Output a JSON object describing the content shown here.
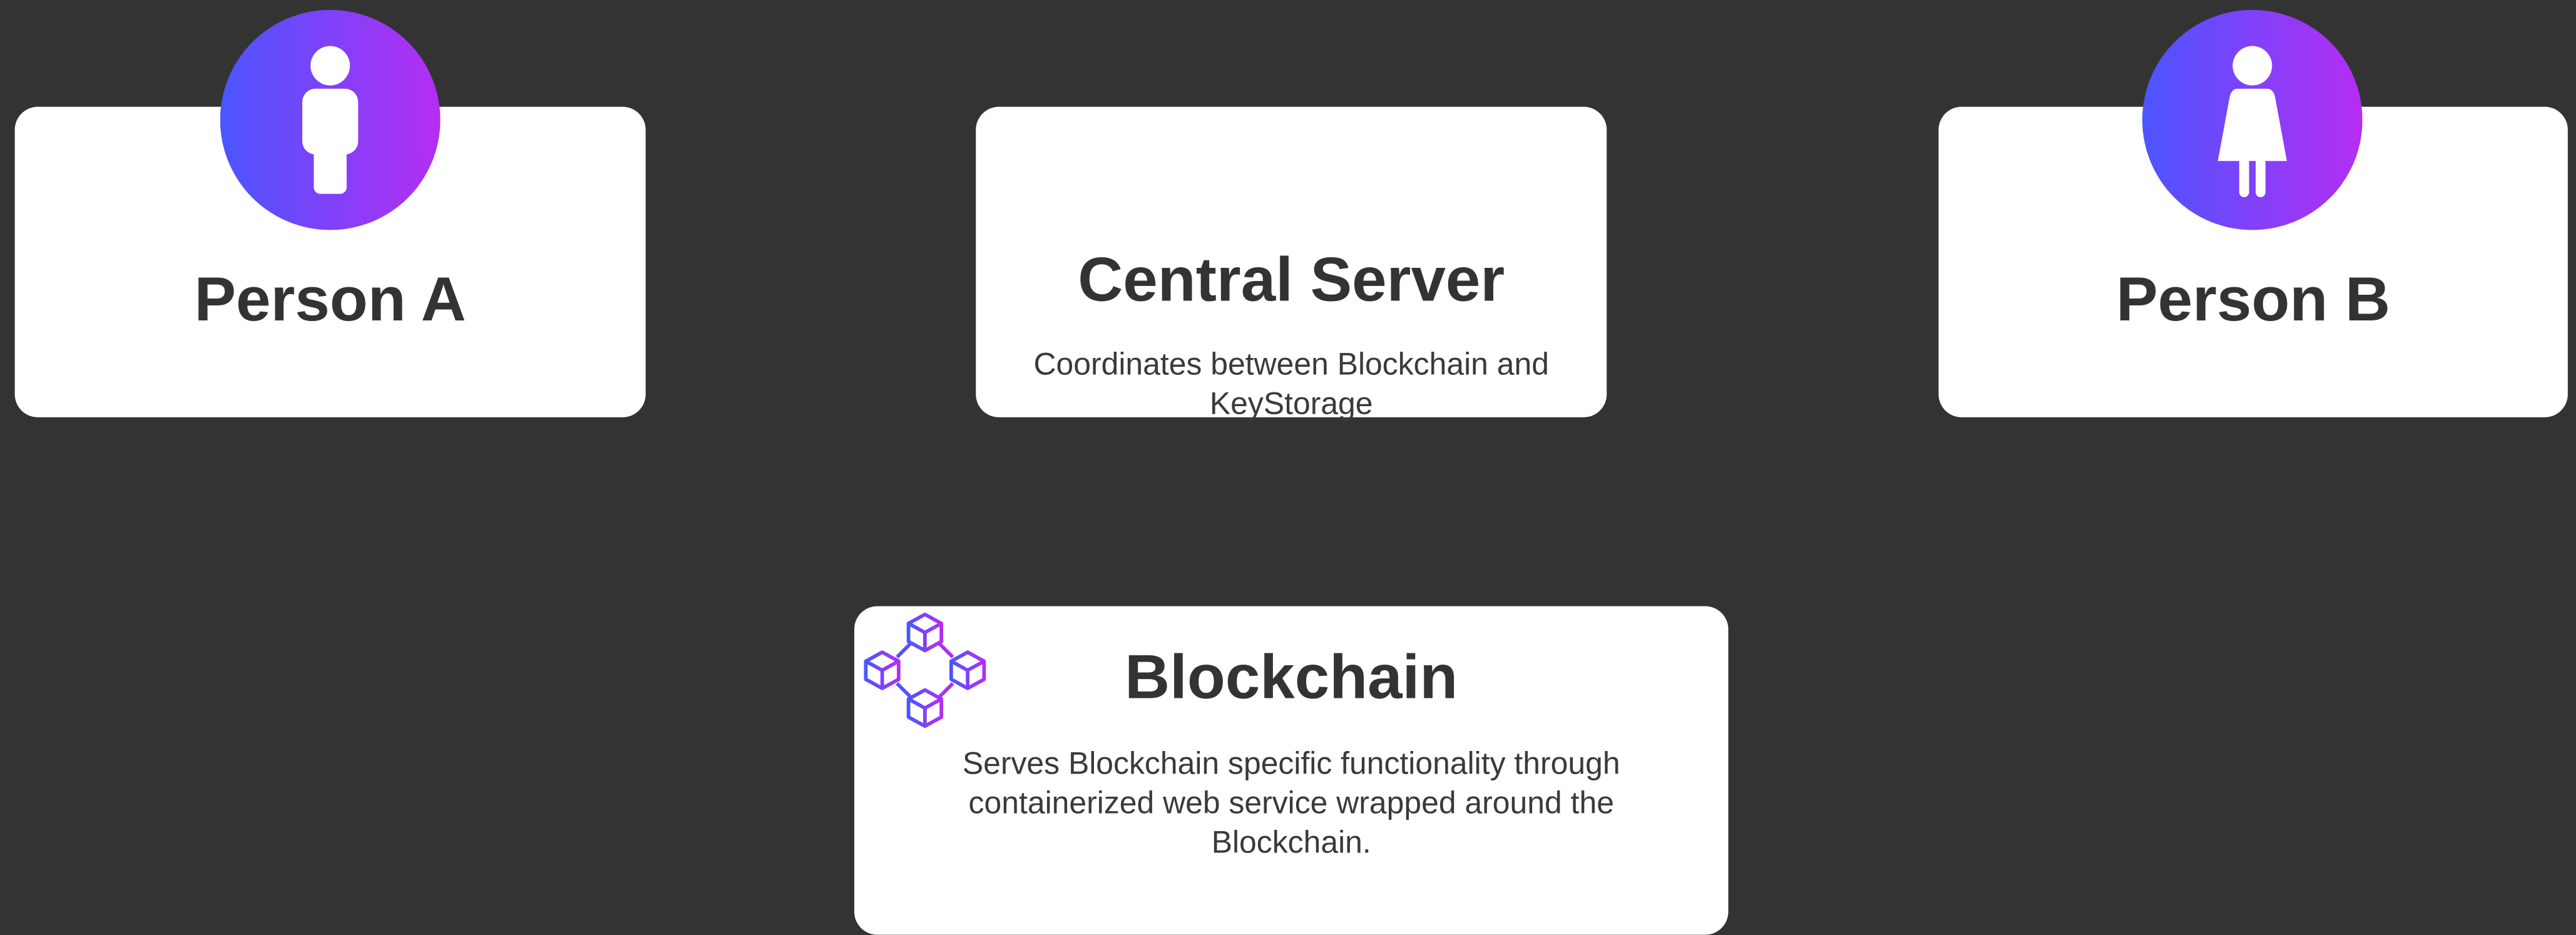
{
  "diagram": {
    "colors": {
      "background": "#333333",
      "card": "#ffffff",
      "text": "#333333",
      "gradient_start": "#4b55ff",
      "gradient_end": "#b52df2"
    },
    "nodes": {
      "person_a": {
        "title": "Person A",
        "icon": "male-person-icon"
      },
      "central_server": {
        "title": "Central Server",
        "description": "Coordinates between Blockchain and KeyStorage"
      },
      "person_b": {
        "title": "Person B",
        "icon": "female-person-icon"
      },
      "blockchain": {
        "title": "Blockchain",
        "icon": "blockchain-network-icon",
        "description": "Serves Blockchain specific functionality through containerized web service wrapped around the Blockchain."
      }
    },
    "edges": [
      {
        "from": "Person A",
        "to": "Central Server",
        "style": "dotted"
      },
      {
        "from": "Central Server",
        "to": "Person B",
        "style": "dotted"
      },
      {
        "from": "Central Server",
        "to": "Blockchain",
        "style": "dotted"
      }
    ]
  }
}
